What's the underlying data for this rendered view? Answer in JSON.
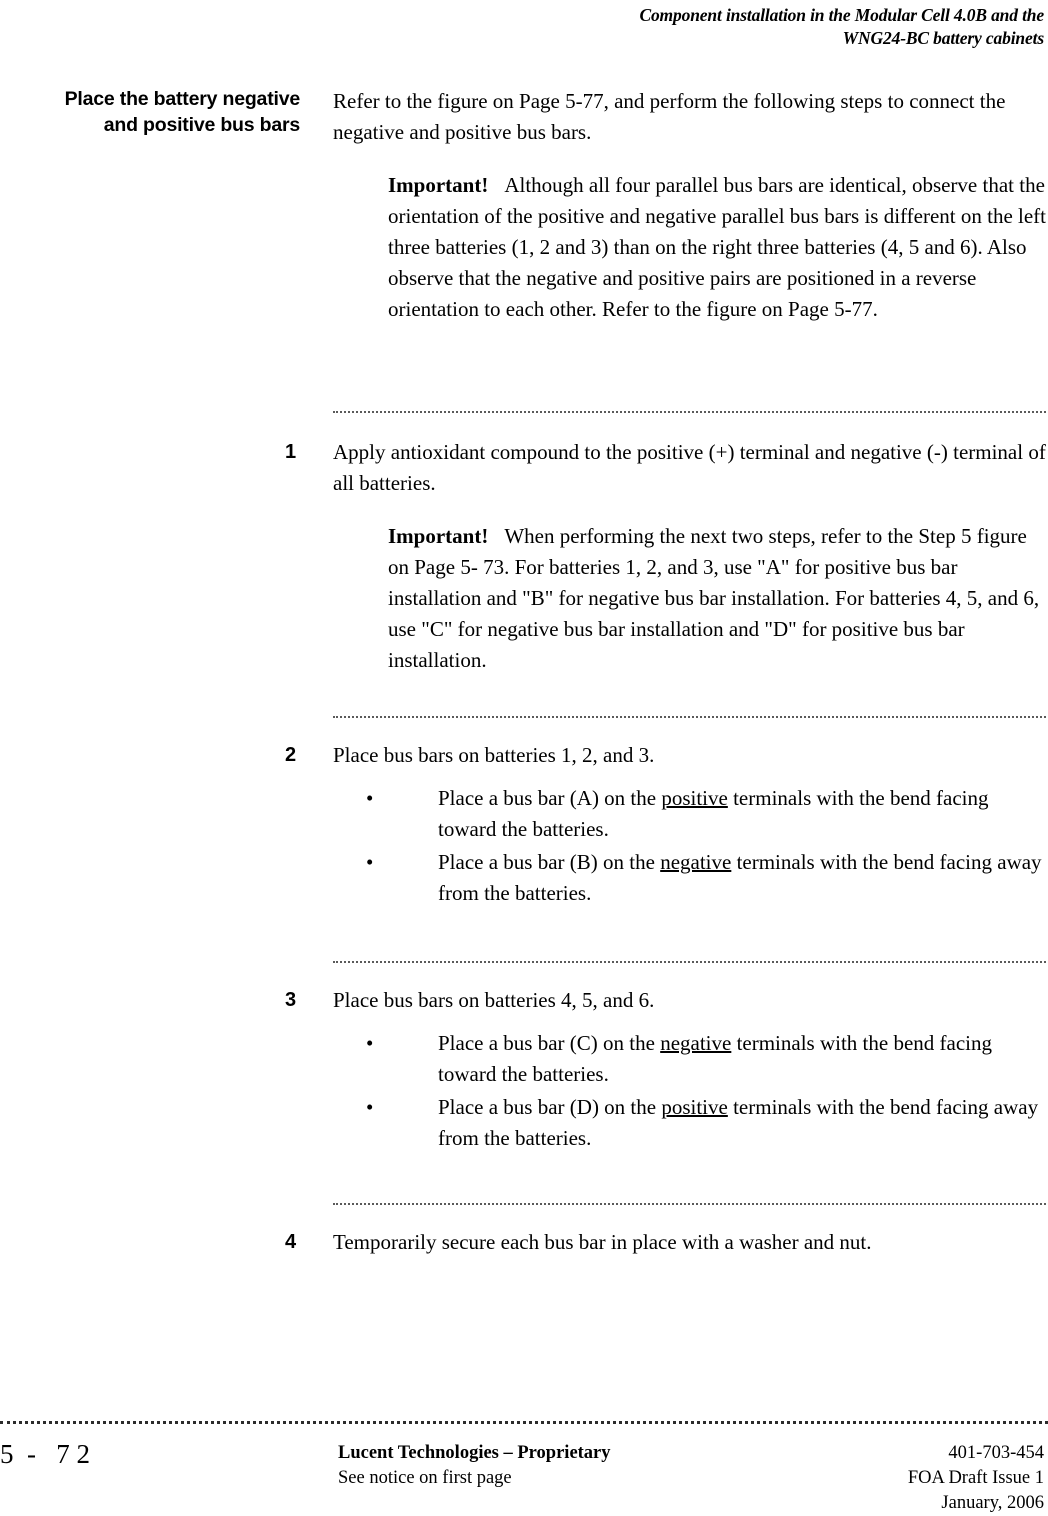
{
  "header": {
    "line1": "Component installation in the Modular Cell 4.0B and the",
    "line2": "WNG24-BC battery cabinets"
  },
  "side_heading": {
    "line1": "Place the battery negative",
    "line2": "and positive bus bars"
  },
  "intro": {
    "text": "Refer to the figure on Page 5-77, and perform the following steps to connect the negative and positive bus bars."
  },
  "note1": {
    "lead": "Important!",
    "text": "Although all four parallel bus bars are identical, observe that the orientation of the positive and negative parallel bus bars is different on the left three batteries (1, 2 and 3) than on the right three batteries (4, 5 and 6). Also observe that the negative and positive pairs are positioned in a reverse orientation to each other. Refer to the figure on Page 5-77."
  },
  "steps": [
    {
      "number": "1",
      "text": "Apply antioxidant compound to the positive (+) terminal and negative (-) terminal of all batteries.",
      "note": {
        "lead": "Important!",
        "text": "When performing the next two steps, refer to the Step 5 figure on Page 5- 73. For batteries 1, 2, and 3, use \"A\" for positive bus bar installation and \"B\" for negative bus bar installation. For batteries 4, 5, and 6, use \"C\" for negative bus bar installation and \"D\" for positive bus bar installation."
      }
    },
    {
      "number": "2",
      "text": "Place bus bars on batteries 1, 2, and 3.",
      "bullets": [
        {
          "marker": "•",
          "pre": "Place a bus bar (A) on the ",
          "emphasis": "positive",
          "post": " terminals with the bend facing toward the batteries."
        },
        {
          "marker": "•",
          "pre": "Place a bus bar (B) on the ",
          "emphasis": "negative",
          "post": " terminals with the bend facing away from the batteries."
        }
      ]
    },
    {
      "number": "3",
      "text": "Place bus bars on batteries 4, 5, and 6.",
      "bullets": [
        {
          "marker": "•",
          "pre": "Place a bus bar (C) on the ",
          "emphasis": "negative",
          "post": " terminals with the bend facing toward the batteries."
        },
        {
          "marker": "•",
          "pre": "Place a bus bar (D) on the ",
          "emphasis": "positive",
          "post": " terminals with the bend facing away from the batteries."
        }
      ]
    },
    {
      "number": "4",
      "text": "Temporarily secure each bus bar in place with a washer and nut."
    }
  ],
  "footer": {
    "folio": "5  -   7 2",
    "center_title": "Lucent Technologies – Proprietary",
    "center_sub": "See notice on first page",
    "right_line1": "401-703-454",
    "right_line2": "FOA Draft Issue 1",
    "right_line3": "January, 2006"
  }
}
